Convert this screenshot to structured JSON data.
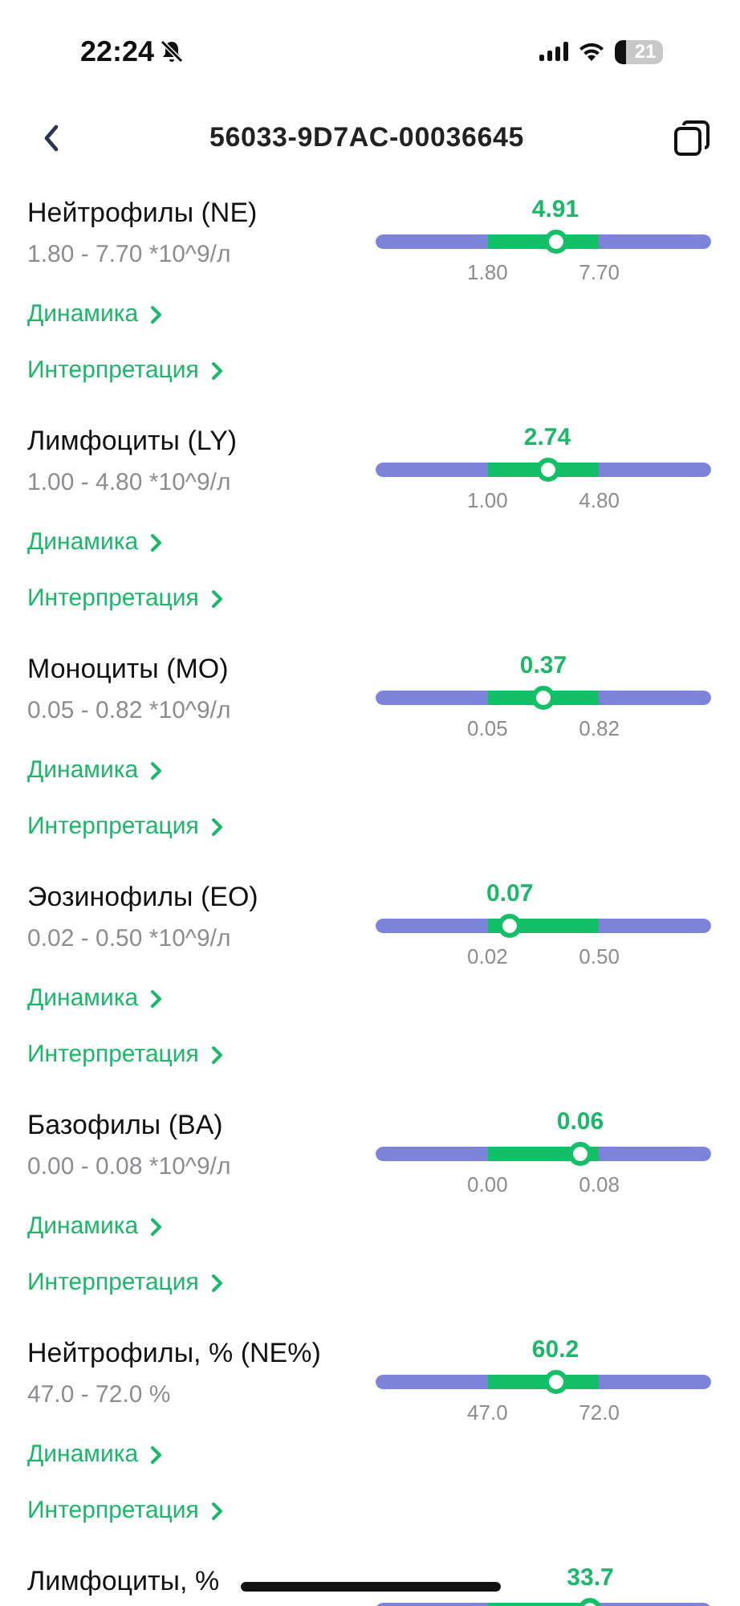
{
  "status_bar": {
    "time": "22:24",
    "silent": true,
    "battery": "21"
  },
  "header": {
    "title": "56033-9D7AC-00036645"
  },
  "results": [
    {
      "name": "Нейтрофилы (NE)",
      "range": "1.80 - 7.70 *10^9/л",
      "value": "4.91",
      "level": 0.536,
      "min_label": "1.80",
      "max_label": "7.70",
      "links": [
        "Динамика",
        "Интерпретация"
      ]
    },
    {
      "name": "Лимфоциты (LY)",
      "range": "1.00 - 4.80 *10^9/л",
      "value": "2.74",
      "level": 0.512,
      "min_label": "1.00",
      "max_label": "4.80",
      "links": [
        "Динамика",
        "Интерпретация"
      ]
    },
    {
      "name": "Моноциты (MO)",
      "range": "0.05 - 0.82 *10^9/л",
      "value": "0.37",
      "level": 0.5,
      "min_label": "0.05",
      "max_label": "0.82",
      "links": [
        "Динамика",
        "Интерпретация"
      ]
    },
    {
      "name": "Эозинофилы (EO)",
      "range": "0.02 - 0.50 *10^9/л",
      "value": "0.07",
      "level": 0.4,
      "min_label": "0.02",
      "max_label": "0.50",
      "links": [
        "Динамика",
        "Интерпретация"
      ]
    },
    {
      "name": "Базофилы (BA)",
      "range": "0.00 - 0.08 *10^9/л",
      "value": "0.06",
      "level": 0.61,
      "min_label": "0.00",
      "max_label": "0.08",
      "links": [
        "Динамика",
        "Интерпретация"
      ]
    },
    {
      "name": "Нейтрофилы, % (NE%)",
      "range": "47.0 - 72.0 %",
      "value": "60.2",
      "level": 0.536,
      "min_label": "47.0",
      "max_label": "72.0",
      "links": [
        "Динамика",
        "Интерпретация"
      ]
    },
    {
      "name": "Лимфоциты, %",
      "value": "33.7",
      "level": 0.64
    }
  ]
}
